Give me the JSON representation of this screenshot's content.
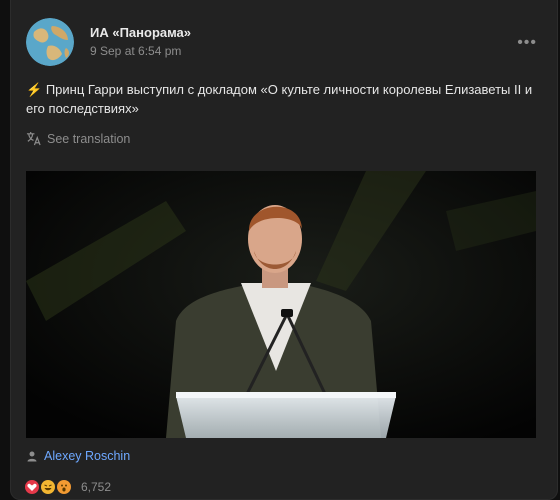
{
  "post": {
    "channel_name": "ИА «Панорама»",
    "date": "9 Sep at 6:54 pm",
    "more_label": "•••",
    "text_icon": "⚡",
    "text": "Принц Гарри выступил с докладом «О культе личности королевы Елизаветы II и его последствиях»",
    "translate_label": "See translation",
    "author": "Alexey Roschin",
    "reactions_count": "6,752",
    "reaction_icons": [
      "heart-reaction-icon",
      "laugh-reaction-icon",
      "wow-reaction-icon"
    ]
  }
}
